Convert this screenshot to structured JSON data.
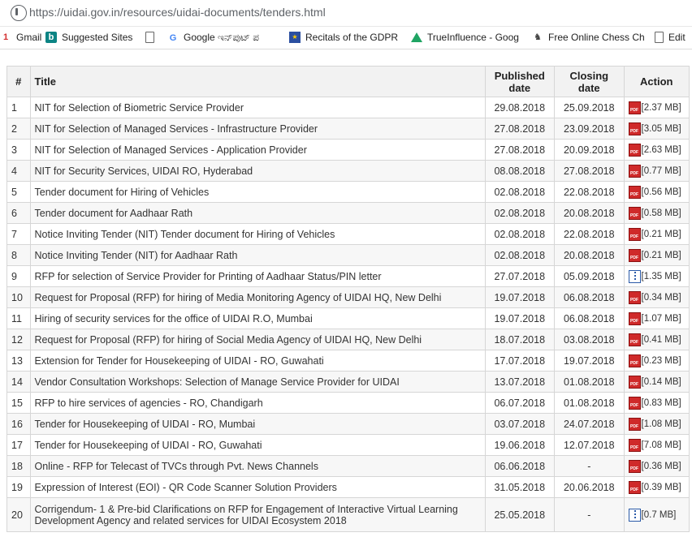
{
  "browser": {
    "url": "https://uidai.gov.in/resources/uidai-documents/tenders.html",
    "bookmarks": [
      {
        "icon": "red-bookmark-icon",
        "label": "Gmail"
      },
      {
        "icon": "bing-icon",
        "label": "Suggested Sites"
      },
      {
        "icon": "document-icon",
        "label": ""
      },
      {
        "icon": "google-icon",
        "label": "Google ಇನ್‌ಪುಟ್ ಪ"
      },
      {
        "icon": "eu-flag-icon",
        "label": "Recitals of the GDPR"
      },
      {
        "icon": "google-drive-icon",
        "label": "TrueInfluence - Goog"
      },
      {
        "icon": "chess-knight-icon",
        "label": "Free Online Chess Ch"
      },
      {
        "icon": "document-icon",
        "label": "Edit"
      }
    ]
  },
  "table": {
    "headers": {
      "num": "#",
      "title": "Title",
      "published": "Published date",
      "closing": "Closing date",
      "action": "Action"
    },
    "rows": [
      {
        "num": "1",
        "title": "NIT for Selection of Biometric Service Provider",
        "published": "29.08.2018",
        "closing": "25.09.2018",
        "file_type": "pdf",
        "size": "[2.37 MB]"
      },
      {
        "num": "2",
        "title": "NIT for Selection of Managed Services - Infrastructure Provider",
        "published": "27.08.2018",
        "closing": "23.09.2018",
        "file_type": "pdf",
        "size": "[3.05 MB]"
      },
      {
        "num": "3",
        "title": "NIT for Selection of Managed Services - Application Provider",
        "published": "27.08.2018",
        "closing": "20.09.2018",
        "file_type": "pdf",
        "size": "[2.63 MB]"
      },
      {
        "num": "4",
        "title": "NIT for Security Services, UIDAI RO, Hyderabad",
        "published": "08.08.2018",
        "closing": "27.08.2018",
        "file_type": "pdf",
        "size": "[0.77 MB]"
      },
      {
        "num": "5",
        "title": "Tender document for Hiring of Vehicles",
        "published": "02.08.2018",
        "closing": "22.08.2018",
        "file_type": "pdf",
        "size": "[0.56 MB]"
      },
      {
        "num": "6",
        "title": "Tender document for Aadhaar Rath",
        "published": "02.08.2018",
        "closing": "20.08.2018",
        "file_type": "pdf",
        "size": "[0.58 MB]"
      },
      {
        "num": "7",
        "title": "Notice Inviting Tender (NIT) Tender document for Hiring of Vehicles",
        "published": "02.08.2018",
        "closing": "22.08.2018",
        "file_type": "pdf",
        "size": "[0.21 MB]"
      },
      {
        "num": "8",
        "title": "Notice Inviting Tender (NIT) for Aadhaar Rath",
        "published": "02.08.2018",
        "closing": "20.08.2018",
        "file_type": "pdf",
        "size": "[0.21 MB]"
      },
      {
        "num": "9",
        "title": "RFP for selection of Service Provider for Printing of Aadhaar Status/PIN letter",
        "published": "27.07.2018",
        "closing": "05.09.2018",
        "file_type": "zip",
        "size": "[1.35 MB]"
      },
      {
        "num": "10",
        "title": "Request for Proposal (RFP) for hiring of Media Monitoring Agency of UIDAI HQ, New Delhi",
        "published": "19.07.2018",
        "closing": "06.08.2018",
        "file_type": "pdf",
        "size": "[0.34 MB]"
      },
      {
        "num": "11",
        "title": "Hiring of security services for the office of UIDAI R.O, Mumbai",
        "published": "19.07.2018",
        "closing": "06.08.2018",
        "file_type": "pdf",
        "size": "[1.07 MB]"
      },
      {
        "num": "12",
        "title": "Request for Proposal (RFP) for hiring of Social Media Agency of UIDAI HQ, New Delhi",
        "published": "18.07.2018",
        "closing": "03.08.2018",
        "file_type": "pdf",
        "size": "[0.41 MB]"
      },
      {
        "num": "13",
        "title": "Extension for Tender for Housekeeping of UIDAI - RO, Guwahati",
        "published": "17.07.2018",
        "closing": "19.07.2018",
        "file_type": "pdf",
        "size": "[0.23 MB]"
      },
      {
        "num": "14",
        "title": "Vendor Consultation Workshops: Selection of Manage Service Provider for UIDAI",
        "published": "13.07.2018",
        "closing": "01.08.2018",
        "file_type": "pdf",
        "size": "[0.14 MB]"
      },
      {
        "num": "15",
        "title": "RFP to hire services of agencies - RO, Chandigarh",
        "published": "06.07.2018",
        "closing": "01.08.2018",
        "file_type": "pdf",
        "size": "[0.83 MB]"
      },
      {
        "num": "16",
        "title": "Tender for Housekeeping of UIDAI - RO, Mumbai",
        "published": "03.07.2018",
        "closing": "24.07.2018",
        "file_type": "pdf",
        "size": "[1.08 MB]"
      },
      {
        "num": "17",
        "title": "Tender for Housekeeping of UIDAI - RO, Guwahati",
        "published": "19.06.2018",
        "closing": "12.07.2018",
        "file_type": "pdf",
        "size": "[7.08 MB]"
      },
      {
        "num": "18",
        "title": "Online - RFP for Telecast of TVCs through Pvt. News Channels",
        "published": "06.06.2018",
        "closing": "-",
        "file_type": "pdf",
        "size": "[0.36 MB]"
      },
      {
        "num": "19",
        "title": "Expression of Interest (EOI) - QR Code Scanner Solution Providers",
        "published": "31.05.2018",
        "closing": "20.06.2018",
        "file_type": "pdf",
        "size": "[0.39 MB]"
      },
      {
        "num": "20",
        "title": "Corrigendum- 1 & Pre-bid Clarifications on RFP for Engagement of Interactive Virtual Learning Development Agency and related services for UIDAI Ecosystem 2018",
        "published": "25.05.2018",
        "closing": "-",
        "file_type": "zip",
        "size": "[0.7 MB]"
      }
    ]
  }
}
